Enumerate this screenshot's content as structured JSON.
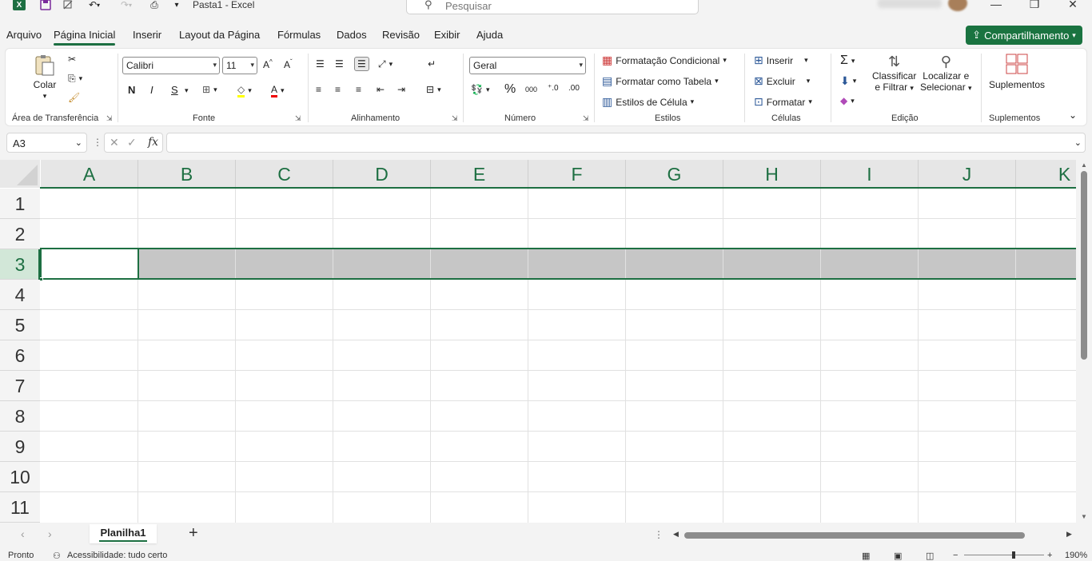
{
  "titlebar": {
    "doc_title": "Pasta1  -  Excel",
    "search_placeholder": "Pesquisar",
    "minimize": "—",
    "restore": "❐",
    "close": "✕"
  },
  "menu": {
    "tabs": [
      "Arquivo",
      "Página Inicial",
      "Inserir",
      "Layout da Página",
      "Fórmulas",
      "Dados",
      "Revisão",
      "Exibir",
      "Ajuda"
    ],
    "share_label": "Compartilhamento"
  },
  "ribbon": {
    "clipboard": {
      "paste": "Colar",
      "label": "Área de Transferência"
    },
    "font": {
      "name": "Calibri",
      "size": "11",
      "bold": "N",
      "italic": "I",
      "underline": "S",
      "label": "Fonte"
    },
    "alignment": {
      "label": "Alinhamento"
    },
    "number": {
      "format": "Geral",
      "label": "Número",
      "percent": "%",
      "thousands": "000"
    },
    "styles": {
      "conditional": "Formatação Condicional",
      "as_table": "Formatar como Tabela",
      "cell_styles": "Estilos de Célula",
      "label": "Estilos"
    },
    "cells": {
      "insert": "Inserir",
      "delete": "Excluir",
      "format": "Formatar",
      "label": "Células"
    },
    "editing": {
      "sort_1": "Classificar",
      "sort_2": "e Filtrar",
      "find_1": "Localizar e",
      "find_2": "Selecionar",
      "label": "Edição"
    },
    "addins": {
      "button": "Suplementos",
      "label": "Suplementos"
    }
  },
  "formula_bar": {
    "name_box": "A3",
    "fx": "fx",
    "value": ""
  },
  "grid": {
    "columns": [
      "A",
      "B",
      "C",
      "D",
      "E",
      "F",
      "G",
      "H",
      "I",
      "J",
      "K"
    ],
    "rows": [
      "1",
      "2",
      "3",
      "4",
      "5",
      "6",
      "7",
      "8",
      "9",
      "10",
      "11"
    ],
    "selected_row": "3",
    "active_cell": "A3"
  },
  "sheets": {
    "tabs": [
      "Planilha1"
    ],
    "add": "+"
  },
  "status": {
    "ready": "Pronto",
    "accessibility": "Acessibilidade: tudo certo",
    "zoom": "190%"
  },
  "colors": {
    "accent": "#1d6f42",
    "selection": "#c6c6c6"
  }
}
